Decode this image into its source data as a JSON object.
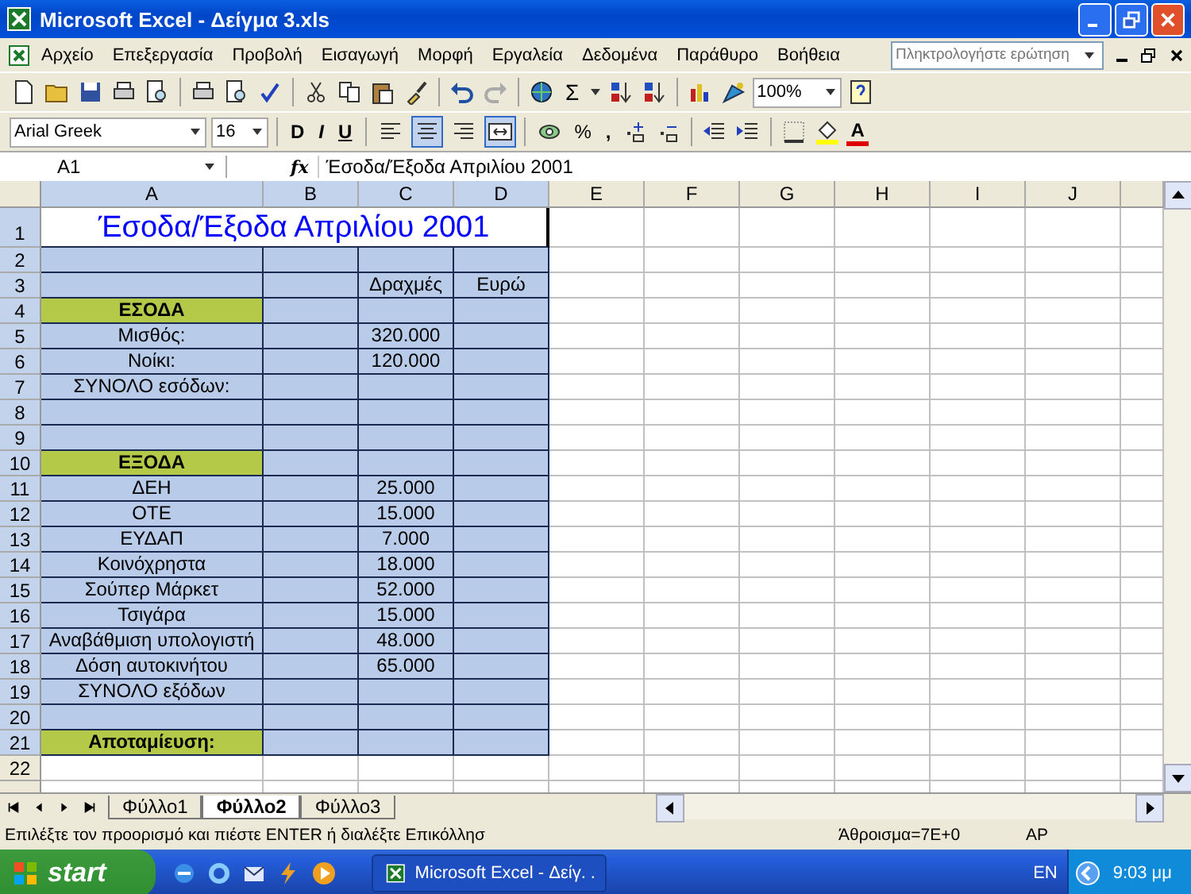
{
  "window": {
    "title": "Microsoft Excel - Δείγμα 3.xls"
  },
  "menu": [
    "Αρχείο",
    "Επεξεργασία",
    "Προβολή",
    "Εισαγωγή",
    "Μορφή",
    "Εργαλεία",
    "Δεδομένα",
    "Παράθυρο",
    "Βοήθεια"
  ],
  "help_box": {
    "placeholder": "Πληκτρολογήστε ερώτηση"
  },
  "standard_toolbar": {
    "sum": "Σ",
    "zoom": "100%"
  },
  "formatting_toolbar": {
    "font": "Arial Greek",
    "size": "16",
    "bold": "D",
    "italic": "I",
    "underline": "U",
    "percent": "%",
    "comma": ",",
    "font_color": "A",
    "center_on": true,
    "merge_on": true
  },
  "formula_bar": {
    "name_box": "A1",
    "fx": "fx",
    "value": "Έσοδα/Έξοδα Απριλίου 2001"
  },
  "sheet": {
    "columns": [
      "A",
      "B",
      "C",
      "D",
      "E",
      "F",
      "G",
      "H",
      "I",
      "J"
    ],
    "rows": [
      {
        "header": "1",
        "kind": "title",
        "A": {
          "text": "Έσοδα/Έξοδα Απριλίου 2001"
        }
      },
      {
        "header": "2",
        "kind": "item"
      },
      {
        "header": "3",
        "kind": "item",
        "C": {
          "text": "Δραχμές"
        },
        "D": {
          "text": "Ευρώ"
        }
      },
      {
        "header": "4",
        "kind": "section",
        "A": {
          "text": "ΕΣΟΔΑ"
        }
      },
      {
        "header": "5",
        "kind": "item",
        "A": {
          "text": "Μισθός:"
        },
        "C": {
          "text": "320.000"
        }
      },
      {
        "header": "6",
        "kind": "item",
        "A": {
          "text": "Νοίκι:"
        },
        "C": {
          "text": "120.000"
        }
      },
      {
        "header": "7",
        "kind": "item",
        "A": {
          "text": "ΣΥΝΟΛΟ εσόδων:"
        }
      },
      {
        "header": "8",
        "kind": "item"
      },
      {
        "header": "9",
        "kind": "item"
      },
      {
        "header": "10",
        "kind": "section",
        "A": {
          "text": "ΕΞΟΔΑ"
        }
      },
      {
        "header": "11",
        "kind": "item",
        "A": {
          "text": "ΔΕΗ"
        },
        "C": {
          "text": "25.000"
        }
      },
      {
        "header": "12",
        "kind": "item",
        "A": {
          "text": "ΟΤΕ"
        },
        "C": {
          "text": "15.000"
        }
      },
      {
        "header": "13",
        "kind": "item",
        "A": {
          "text": "ΕΥΔΑΠ"
        },
        "C": {
          "text": "7.000"
        }
      },
      {
        "header": "14",
        "kind": "item",
        "A": {
          "text": "Κοινόχρηστα"
        },
        "C": {
          "text": "18.000"
        }
      },
      {
        "header": "15",
        "kind": "item",
        "A": {
          "text": "Σούπερ Μάρκετ"
        },
        "C": {
          "text": "52.000"
        }
      },
      {
        "header": "16",
        "kind": "item",
        "A": {
          "text": "Τσιγάρα"
        },
        "C": {
          "text": "15.000"
        }
      },
      {
        "header": "17",
        "kind": "item",
        "A": {
          "text": "Αναβάθμιση υπολογιστή"
        },
        "C": {
          "text": "48.000"
        }
      },
      {
        "header": "18",
        "kind": "item",
        "A": {
          "text": "Δόση αυτοκινήτου"
        },
        "C": {
          "text": "65.000"
        }
      },
      {
        "header": "19",
        "kind": "item",
        "A": {
          "text": "ΣΥΝΟΛΟ εξόδων"
        }
      },
      {
        "header": "20",
        "kind": "item"
      },
      {
        "header": "21",
        "kind": "section",
        "A": {
          "text": "Αποταμίευση:"
        }
      },
      {
        "header": "22"
      }
    ]
  },
  "sheet_tabs": [
    {
      "label": "Φύλλο1",
      "selected": false
    },
    {
      "label": "Φύλλο2",
      "selected": true
    },
    {
      "label": "Φύλλο3",
      "selected": false
    }
  ],
  "status_bar": {
    "message": "Επιλέξτε τον προορισμό και πιέστε ENTER ή διαλέξτε Επικόλλησ",
    "sum": "Άθροισμα=7E+0",
    "mode": "ΑΡ"
  },
  "taskbar": {
    "start": "start",
    "task": "Microsoft Excel - Δείγ. .",
    "language": "EN",
    "clock": "9:03 μμ"
  }
}
